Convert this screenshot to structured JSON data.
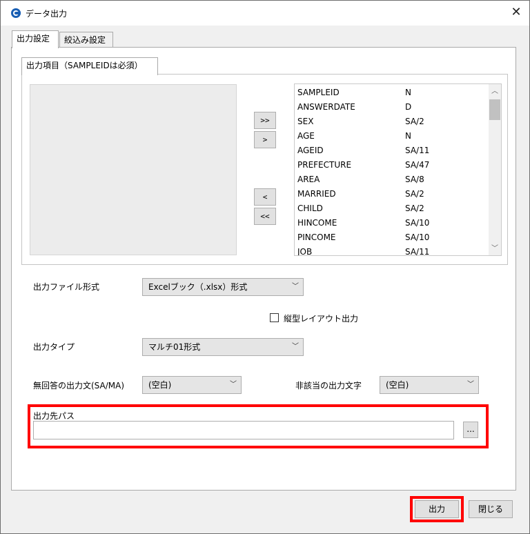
{
  "window": {
    "title": "データ出力",
    "close_glyph": "✕"
  },
  "tabs": [
    {
      "label": "出力設定"
    },
    {
      "label": "絞込み設定"
    }
  ],
  "subtab": {
    "label": "出力項目（SAMPLEIDは必須）"
  },
  "arrows": {
    "add_all": ">>",
    "add": ">",
    "remove": "<",
    "remove_all": "<<"
  },
  "columns": [
    {
      "name": "SAMPLEID",
      "type": "N"
    },
    {
      "name": "ANSWERDATE",
      "type": "D"
    },
    {
      "name": "SEX",
      "type": "SA/2"
    },
    {
      "name": "AGE",
      "type": "N"
    },
    {
      "name": "AGEID",
      "type": "SA/11"
    },
    {
      "name": "PREFECTURE",
      "type": "SA/47"
    },
    {
      "name": "AREA",
      "type": "SA/8"
    },
    {
      "name": "MARRIED",
      "type": "SA/2"
    },
    {
      "name": "CHILD",
      "type": "SA/2"
    },
    {
      "name": "HINCOME",
      "type": "SA/10"
    },
    {
      "name": "PINCOME",
      "type": "SA/10"
    },
    {
      "name": "JOB",
      "type": "SA/11"
    }
  ],
  "form": {
    "file_format_label": "出力ファイル形式",
    "file_format_value": "Excelブック（.xlsx）形式",
    "vertical_layout_label": "縦型レイアウト出力",
    "output_type_label": "出力タイプ",
    "output_type_value": "マルチ01形式",
    "no_answer_label": "無回答の出力文(SA/MA)",
    "no_answer_value": "(空白)",
    "not_applicable_label": "非該当の出力文字",
    "not_applicable_value": "(空白)",
    "output_path_label": "出力先パス",
    "output_path_value": "",
    "browse_label": "..."
  },
  "footer": {
    "output_button": "出力",
    "close_button": "閉じる"
  },
  "colors": {
    "highlight": "#ff0000",
    "app_icon": "#1a5fb4"
  }
}
